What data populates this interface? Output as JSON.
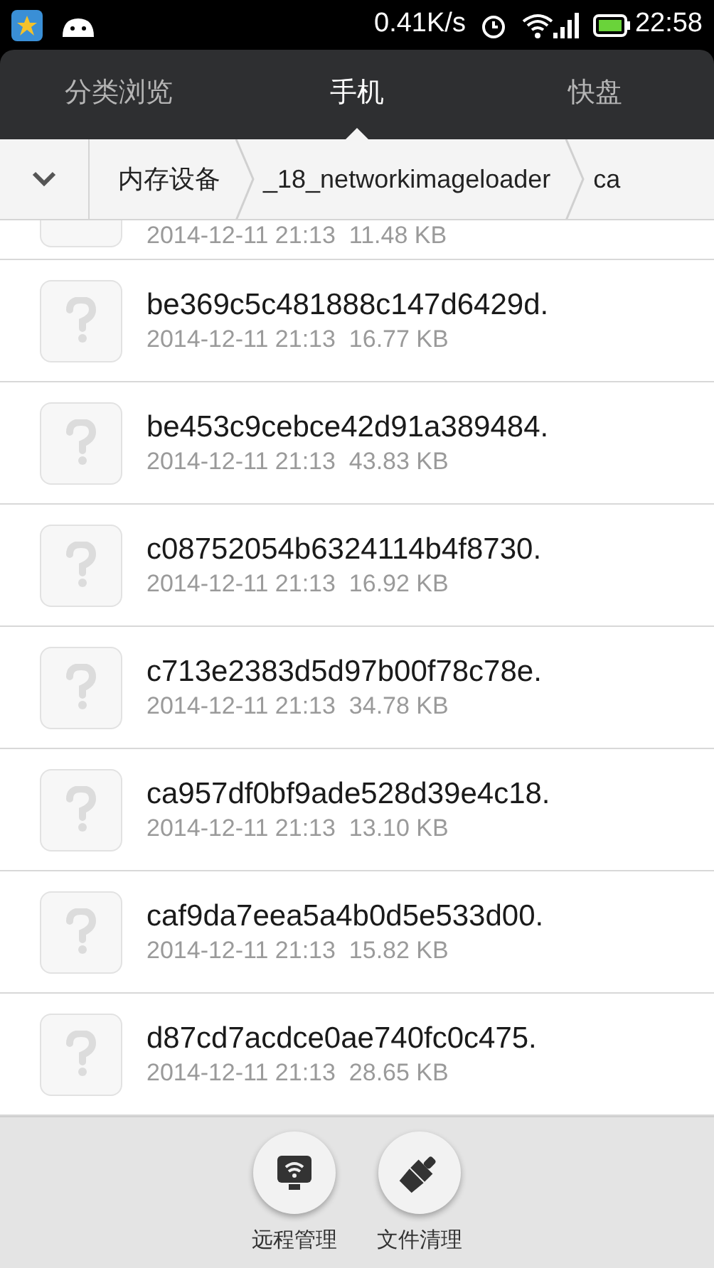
{
  "status_bar": {
    "speed": "0.41K/s",
    "time": "22:58"
  },
  "tabs": [
    {
      "label": "分类浏览",
      "selected": false
    },
    {
      "label": "手机",
      "selected": true
    },
    {
      "label": "快盘",
      "selected": false
    }
  ],
  "breadcrumb": [
    "内存设备",
    "_18_networkimageloader",
    "ca"
  ],
  "files": [
    {
      "kind": "partial",
      "meta": "2014-12-11 21:13  11.48 KB"
    },
    {
      "kind": "full",
      "name": "be369c5c481888c147d6429d.",
      "meta": "2014-12-11 21:13  16.77 KB"
    },
    {
      "kind": "full",
      "name": "be453c9cebce42d91a389484.",
      "meta": "2014-12-11 21:13  43.83 KB"
    },
    {
      "kind": "full",
      "name": "c08752054b6324114b4f8730.",
      "meta": "2014-12-11 21:13  16.92 KB"
    },
    {
      "kind": "full",
      "name": "c713e2383d5d97b00f78c78e.",
      "meta": "2014-12-11 21:13  34.78 KB"
    },
    {
      "kind": "full",
      "name": "ca957df0bf9ade528d39e4c18.",
      "meta": "2014-12-11 21:13  13.10 KB"
    },
    {
      "kind": "full",
      "name": "caf9da7eea5a4b0d5e533d00.",
      "meta": "2014-12-11 21:13  15.82 KB"
    },
    {
      "kind": "full",
      "name": "d87cd7acdce0ae740fc0c475.",
      "meta": "2014-12-11 21:13  28.65 KB"
    }
  ],
  "actions": [
    {
      "kind": "remote",
      "label": "远程管理"
    },
    {
      "kind": "clean",
      "label": "文件清理"
    }
  ]
}
